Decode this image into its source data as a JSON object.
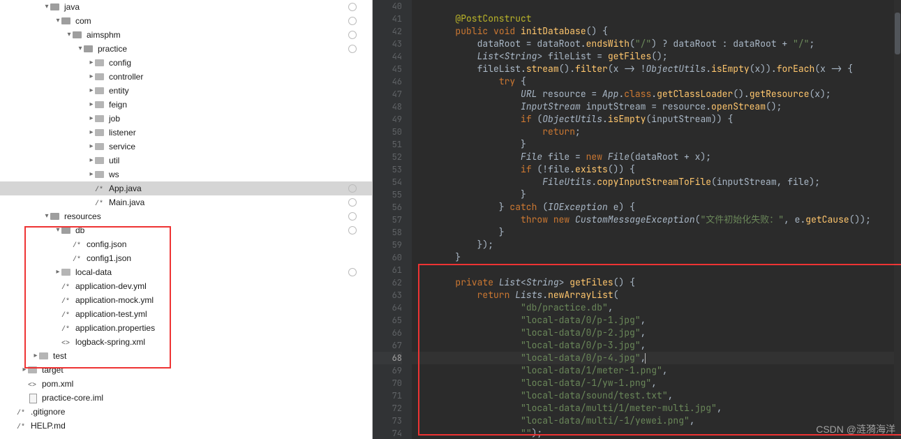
{
  "tree": [
    {
      "depth": 2,
      "caret": "down",
      "icon": "folder",
      "label": "java",
      "circle": true
    },
    {
      "depth": 3,
      "caret": "down",
      "icon": "folder",
      "label": "com",
      "circle": true
    },
    {
      "depth": 4,
      "caret": "down",
      "icon": "folder",
      "label": "aimsphm",
      "circle": true
    },
    {
      "depth": 5,
      "caret": "down",
      "icon": "folder",
      "label": "practice",
      "circle": true
    },
    {
      "depth": 6,
      "caret": "right",
      "icon": "folder",
      "label": "config"
    },
    {
      "depth": 6,
      "caret": "right",
      "icon": "folder",
      "label": "controller"
    },
    {
      "depth": 6,
      "caret": "right",
      "icon": "folder",
      "label": "entity"
    },
    {
      "depth": 6,
      "caret": "right",
      "icon": "folder",
      "label": "feign"
    },
    {
      "depth": 6,
      "caret": "right",
      "icon": "folder",
      "label": "job"
    },
    {
      "depth": 6,
      "caret": "right",
      "icon": "folder",
      "label": "listener"
    },
    {
      "depth": 6,
      "caret": "right",
      "icon": "folder",
      "label": "service"
    },
    {
      "depth": 6,
      "caret": "right",
      "icon": "folder",
      "label": "util"
    },
    {
      "depth": 6,
      "caret": "right",
      "icon": "folder",
      "label": "ws"
    },
    {
      "depth": 6,
      "caret": "blank",
      "icon": "file-java",
      "label": "App.java",
      "selected": true,
      "circle": true
    },
    {
      "depth": 6,
      "caret": "blank",
      "icon": "file-java",
      "label": "Main.java",
      "circle": true
    },
    {
      "depth": 2,
      "caret": "down",
      "icon": "folder",
      "label": "resources",
      "circle": true
    },
    {
      "depth": 3,
      "caret": "down",
      "icon": "folder",
      "label": "db",
      "circle": true
    },
    {
      "depth": 4,
      "caret": "blank",
      "icon": "file-json",
      "label": "config.json"
    },
    {
      "depth": 4,
      "caret": "blank",
      "icon": "file-json",
      "label": "config1.json"
    },
    {
      "depth": 3,
      "caret": "right",
      "icon": "folder",
      "label": "local-data",
      "circle": true
    },
    {
      "depth": 3,
      "caret": "blank",
      "icon": "file-yml",
      "label": "application-dev.yml"
    },
    {
      "depth": 3,
      "caret": "blank",
      "icon": "file-yml",
      "label": "application-mock.yml"
    },
    {
      "depth": 3,
      "caret": "blank",
      "icon": "file-yml",
      "label": "application-test.yml"
    },
    {
      "depth": 3,
      "caret": "blank",
      "icon": "file-yml",
      "label": "application.properties"
    },
    {
      "depth": 3,
      "caret": "blank",
      "icon": "file-xml",
      "label": "logback-spring.xml"
    },
    {
      "depth": 1,
      "caret": "right",
      "icon": "folder",
      "label": "test"
    },
    {
      "depth": 0,
      "caret": "right",
      "icon": "folder",
      "label": "target"
    },
    {
      "depth": 0,
      "caret": "blank",
      "icon": "file-xml",
      "label": "pom.xml"
    },
    {
      "depth": 0,
      "caret": "blank",
      "icon": "file-iml",
      "label": "practice-core.iml"
    },
    {
      "depth": -1,
      "caret": "blank",
      "icon": "file-json",
      "label": ".gitignore"
    },
    {
      "depth": -1,
      "caret": "blank",
      "icon": "file-md",
      "label": "HELP.md"
    }
  ],
  "code": {
    "first_line": 40,
    "current_line": 68,
    "lines": [
      {
        "n": 40,
        "html": ""
      },
      {
        "n": 41,
        "html": "        <span class='ann'>@PostConstruct</span>"
      },
      {
        "n": 42,
        "html": "        <span class='kw'>public</span> <span class='kw'>void</span> <span class='mth'>initDatabase</span>() {"
      },
      {
        "n": 43,
        "html": "            dataRoot = dataRoot.<span class='mth'>endsWith</span>(<span class='str'>\"/\"</span>) ? dataRoot : dataRoot + <span class='str'>\"/\"</span>;"
      },
      {
        "n": 44,
        "html": "            <span class='type'>List</span>&lt;<span class='type'>String</span>&gt; fileList = <span class='mth'>getFiles</span>();"
      },
      {
        "n": 45,
        "html": "            fileList.<span class='mth'>stream</span>().<span class='mth'>filter</span>(x -&gt; !<span class='type'>ObjectUtils</span>.<span class='mth'>isEmpty</span>(x)).<span class='mth'>forEach</span>(x -&gt; {"
      },
      {
        "n": 46,
        "html": "                <span class='kw'>try</span> {"
      },
      {
        "n": 47,
        "html": "                    <span class='type'>URL</span> resource = <span class='type'>App</span>.<span class='kw'>class</span>.<span class='mth'>getClassLoader</span>().<span class='mth'>getResource</span>(x);"
      },
      {
        "n": 48,
        "html": "                    <span class='type'>InputStream</span> inputStream = resource.<span class='mth'>openStream</span>();"
      },
      {
        "n": 49,
        "html": "                    <span class='kw'>if</span> (<span class='type'>ObjectUtils</span>.<span class='mth'>isEmpty</span>(inputStream)) {"
      },
      {
        "n": 50,
        "html": "                        <span class='kw'>return</span>;"
      },
      {
        "n": 51,
        "html": "                    }"
      },
      {
        "n": 52,
        "html": "                    <span class='type'>File</span> file = <span class='kw'>new</span> <span class='type'>File</span>(dataRoot + x);"
      },
      {
        "n": 53,
        "html": "                    <span class='kw'>if</span> (!file.<span class='mth'>exists</span>()) {"
      },
      {
        "n": 54,
        "html": "                        <span class='type'>FileUtils</span>.<span class='mth'>copyInputStreamToFile</span>(inputStream, file);"
      },
      {
        "n": 55,
        "html": "                    }"
      },
      {
        "n": 56,
        "html": "                } <span class='kw'>catch</span> (<span class='type'>IOException</span> e) {"
      },
      {
        "n": 57,
        "html": "                    <span class='kw'>throw new</span> <span class='type'>CustomMessageException</span>(<span class='str'>\"文件初始化失败：\"</span>, e.<span class='mth'>getCause</span>());"
      },
      {
        "n": 58,
        "html": "                }"
      },
      {
        "n": 59,
        "html": "            });"
      },
      {
        "n": 60,
        "html": "        }"
      },
      {
        "n": 61,
        "html": ""
      },
      {
        "n": 62,
        "html": "        <span class='kw'>private</span> <span class='type'>List</span>&lt;<span class='type'>String</span>&gt; <span class='mth'>getFiles</span>() {"
      },
      {
        "n": 63,
        "html": "            <span class='kw'>return</span> <span class='type'>Lists</span>.<span class='mth'>newArrayList</span>("
      },
      {
        "n": 64,
        "html": "                    <span class='str'>\"db/practice.db\"</span>,"
      },
      {
        "n": 65,
        "html": "                    <span class='str'>\"local-data/0/p-1.jpg\"</span>,"
      },
      {
        "n": 66,
        "html": "                    <span class='str'>\"local-data/0/p-2.jpg\"</span>,"
      },
      {
        "n": 67,
        "html": "                    <span class='str'>\"local-data/0/p-3.jpg\"</span>,"
      },
      {
        "n": 68,
        "html": "                    <span class='str'>\"local-data/0/p-4.jpg\"</span>,<span class='caret-line'></span>"
      },
      {
        "n": 69,
        "html": "                    <span class='str'>\"local-data/1/meter-1.png\"</span>,"
      },
      {
        "n": 70,
        "html": "                    <span class='str'>\"local-data/-1/yw-1.png\"</span>,"
      },
      {
        "n": 71,
        "html": "                    <span class='str'>\"local-data/sound/test.txt\"</span>,"
      },
      {
        "n": 72,
        "html": "                    <span class='str'>\"local-data/multi/1/meter-multi.jpg\"</span>,"
      },
      {
        "n": 73,
        "html": "                    <span class='str'>\"local-data/multi/-1/yewei.png\"</span>,"
      },
      {
        "n": 74,
        "html": "                    <span class='str'>\"\"</span>);"
      }
    ]
  },
  "watermark": "CSDN @涟漪海洋"
}
